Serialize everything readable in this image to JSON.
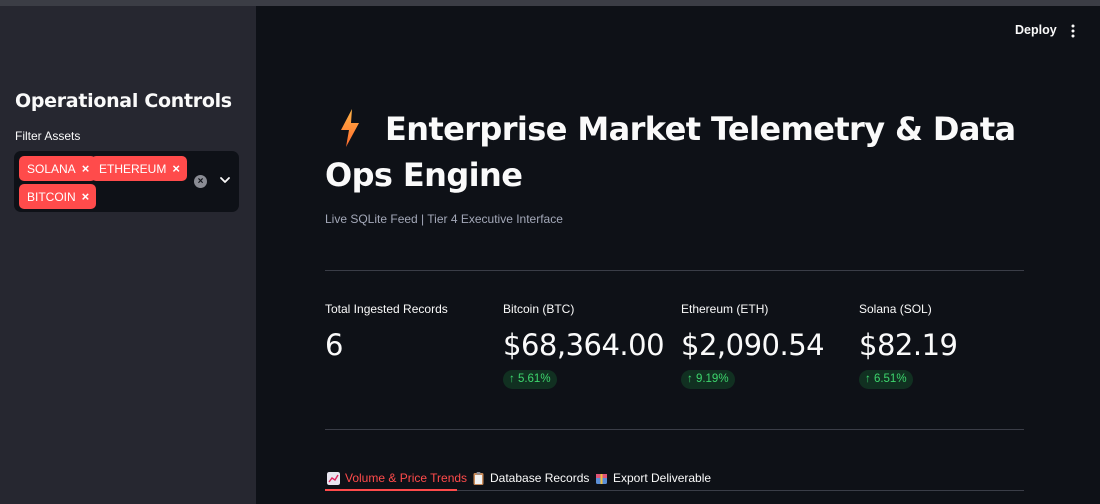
{
  "sidebar": {
    "title": "Operational Controls",
    "filter_label": "Filter Assets",
    "selected_tags": [
      "SOLANA",
      "ETHEREUM",
      "BITCOIN"
    ],
    "tag_remove_glyph": "×",
    "clear_glyph": "×"
  },
  "header": {
    "deploy_label": "Deploy"
  },
  "main": {
    "title": "Enterprise Market Telemetry & Data Ops Engine",
    "subtitle": "Live SQLite Feed | Tier 4 Executive Interface",
    "metrics": [
      {
        "label": "Total Ingested Records",
        "value": "6",
        "delta": null
      },
      {
        "label": "Bitcoin (BTC)",
        "value": "$68,364.00",
        "delta": "↑ 5.61%"
      },
      {
        "label": "Ethereum (ETH)",
        "value": "$2,090.54",
        "delta": "↑ 9.19%"
      },
      {
        "label": "Solana (SOL)",
        "value": "$82.19",
        "delta": "↑ 6.51%"
      }
    ],
    "tabs": [
      {
        "label": "Volume & Price Trends",
        "icon": "chart-icon",
        "active": true
      },
      {
        "label": "Database Records",
        "icon": "clipboard-icon",
        "active": false
      },
      {
        "label": "Export Deliverable",
        "icon": "package-icon",
        "active": false
      }
    ]
  },
  "colors": {
    "accent": "#ff4b4b",
    "background": "#0e1117",
    "sidebar_bg": "#262730",
    "delta_positive": "#3dd56d"
  }
}
